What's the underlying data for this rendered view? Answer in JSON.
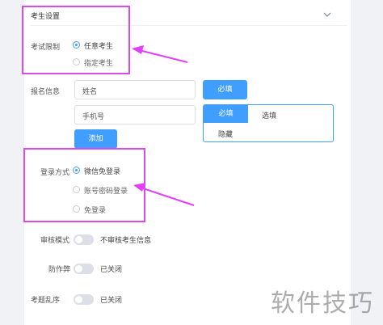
{
  "section": {
    "title": "考生设置"
  },
  "exam_limit": {
    "label": "考试限制",
    "options": [
      "任意考生",
      "指定考生"
    ],
    "selected": "任意考生"
  },
  "signup": {
    "label": "报名信息",
    "fields": [
      {
        "value": "姓名",
        "button": "必填"
      },
      {
        "value": "手机号"
      }
    ],
    "dropdown": {
      "options": [
        "必填",
        "选填",
        "隐藏"
      ],
      "selected": "必填"
    },
    "add_button": "添加"
  },
  "login": {
    "label": "登录方式",
    "options": [
      "微信免登录",
      "账号密码登录",
      "免登录"
    ],
    "selected": "微信免登录"
  },
  "review": {
    "label": "审核模式",
    "status": "不审核考生信息",
    "on": false
  },
  "anti_cheat": {
    "label": "防作弊",
    "status": "已关闭",
    "on": false
  },
  "shuffle": {
    "label": "考题乱序",
    "status": "已关闭",
    "on": false
  },
  "watermark": {
    "text": "软件技巧"
  },
  "colors": {
    "primary": "#409eff",
    "highlight": "#d94ae6",
    "arrow": "#e040fb"
  }
}
